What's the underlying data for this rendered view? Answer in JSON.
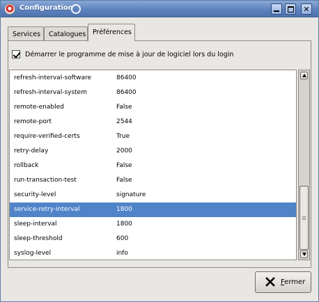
{
  "window": {
    "title": "Configuration"
  },
  "tabs": [
    {
      "label": "Services"
    },
    {
      "label": "Catalogues"
    },
    {
      "label": "Préférences",
      "active": true
    }
  ],
  "preferences": {
    "checkbox_label": "Démarrer le programme de mise à jour de logiciel lors du login",
    "checkbox_checked": true,
    "rows": [
      {
        "key": "refresh-interval-software",
        "value": "86400"
      },
      {
        "key": "refresh-interval-system",
        "value": "86400"
      },
      {
        "key": "remote-enabled",
        "value": "False"
      },
      {
        "key": "remote-port",
        "value": "2544"
      },
      {
        "key": "require-verified-certs",
        "value": "True"
      },
      {
        "key": "retry-delay",
        "value": "2000"
      },
      {
        "key": "rollback",
        "value": "False"
      },
      {
        "key": "run-transaction-test",
        "value": "False"
      },
      {
        "key": "security-level",
        "value": "signature"
      },
      {
        "key": "service-retry-interval",
        "value": "1800",
        "selected": true
      },
      {
        "key": "sleep-interval",
        "value": "1800"
      },
      {
        "key": "sleep-threshold",
        "value": "600"
      },
      {
        "key": "syslog-level",
        "value": "info"
      }
    ]
  },
  "close_button": {
    "label_first": "F",
    "label_rest": "ermer"
  },
  "colors": {
    "selection": "#5084c9",
    "titlebar": "#5e82bd"
  }
}
